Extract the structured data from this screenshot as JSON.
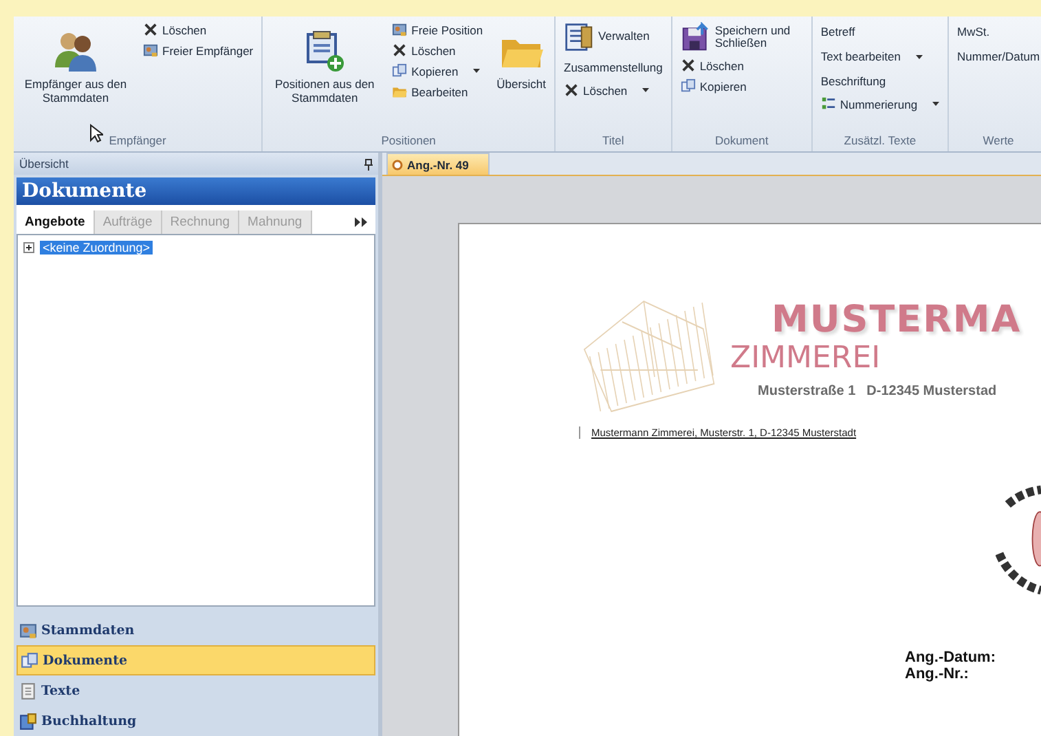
{
  "ribbon": {
    "groups": [
      {
        "label": "Empfänger",
        "columns": [
          [
            {
              "kind": "large",
              "label": "Empfänger aus den Stammdaten",
              "dropdown": false
            }
          ],
          [
            {
              "kind": "small",
              "label": "Löschen",
              "dropdown": false
            },
            {
              "kind": "small",
              "label": "Freier Empfänger",
              "dropdown": false
            }
          ]
        ]
      },
      {
        "label": "Positionen",
        "columns": [
          [
            {
              "kind": "large",
              "label": "Positionen aus den Stammdaten",
              "dropdown": false
            }
          ],
          [
            {
              "kind": "small",
              "label": "Freie Position",
              "dropdown": false
            },
            {
              "kind": "small",
              "label": "Löschen",
              "dropdown": false
            },
            {
              "kind": "small",
              "label": "Kopieren",
              "dropdown": true
            },
            {
              "kind": "small",
              "label": "Bearbeiten",
              "dropdown": false
            }
          ],
          [
            {
              "kind": "large",
              "label": "Übersicht",
              "dropdown": false
            }
          ]
        ]
      },
      {
        "label": "Titel",
        "columns": [
          [
            {
              "kind": "medium",
              "label": "Verwalten",
              "dropdown": false
            },
            {
              "kind": "text",
              "label": "Zusammenstellung",
              "dropdown": false
            },
            {
              "kind": "small",
              "label": "Löschen",
              "dropdown": true
            }
          ]
        ]
      },
      {
        "label": "Dokument",
        "columns": [
          [
            {
              "kind": "medium",
              "label": "Speichern und Schließen",
              "dropdown": false
            },
            {
              "kind": "small",
              "label": "Löschen",
              "dropdown": false
            },
            {
              "kind": "small",
              "label": "Kopieren",
              "dropdown": false
            }
          ]
        ]
      },
      {
        "label": "Zusätzl. Texte",
        "columns": [
          [
            {
              "kind": "text",
              "label": "Betreff",
              "dropdown": false
            },
            {
              "kind": "text",
              "label": "Text bearbeiten",
              "dropdown": true
            },
            {
              "kind": "text",
              "label": "Beschriftung",
              "dropdown": false
            },
            {
              "kind": "small",
              "label": "Nummerierung",
              "dropdown": true
            }
          ]
        ]
      },
      {
        "label": "Werte",
        "columns": [
          [
            {
              "kind": "text",
              "label": "MwSt.",
              "dropdown": false
            },
            {
              "kind": "text",
              "label": "Nummer/Datum",
              "dropdown": false
            }
          ]
        ]
      }
    ]
  },
  "panel": {
    "header": "Übersicht",
    "title": "Dokumente",
    "tabs": [
      {
        "label": "Angebote",
        "selected": true
      },
      {
        "label": "Aufträge",
        "selected": false
      },
      {
        "label": "Rechnung",
        "selected": false
      },
      {
        "label": "Mahnung",
        "selected": false
      }
    ],
    "tree": [
      {
        "label": "<keine Zuordnung>",
        "selected": true,
        "expanded": false
      }
    ],
    "nav": [
      {
        "label": "Stammdaten",
        "selected": false
      },
      {
        "label": "Dokumente",
        "selected": true
      },
      {
        "label": "Texte",
        "selected": false
      },
      {
        "label": "Buchhaltung",
        "selected": false
      }
    ]
  },
  "document": {
    "tabs": [
      {
        "label": "Ang.-Nr. 49",
        "selected": true
      }
    ],
    "letterhead": {
      "name": "MUSTERMA",
      "subtitle": "ZIMMEREI",
      "street": "Musterstraße 1",
      "city": "D-12345 Musterstad"
    },
    "sender_line": "Mustermann Zimmerei, Musterstr. 1, D-12345 Musterstadt",
    "fields": [
      "Ang.-Datum:",
      "Ang.-Nr.:"
    ]
  }
}
